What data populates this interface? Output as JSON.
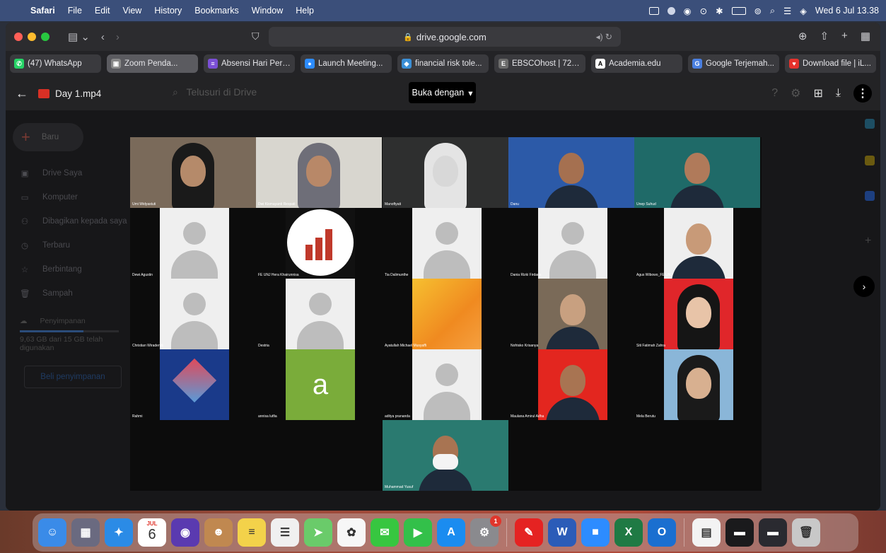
{
  "menubar": {
    "app": "Safari",
    "items": [
      "File",
      "Edit",
      "View",
      "History",
      "Bookmarks",
      "Window",
      "Help"
    ],
    "clock": "Wed 6 Jul 13.38"
  },
  "safari": {
    "url": "drive.google.com",
    "tabs": [
      {
        "label": "(47) WhatsApp",
        "icon": "whatsapp-icon",
        "color": "#25d366",
        "glyph": "✆"
      },
      {
        "label": "Zoom Penda...",
        "icon": "zoom-icon",
        "color": "#888888",
        "glyph": "▣",
        "active": true
      },
      {
        "label": "Absensi Hari Pert...",
        "icon": "forms-icon",
        "color": "#7b4fd6",
        "glyph": "≡"
      },
      {
        "label": "Launch Meeting...",
        "icon": "zoom-icon",
        "color": "#2d8cff",
        "glyph": "●"
      },
      {
        "label": "financial risk tole...",
        "icon": "web-icon",
        "color": "#3b8fd6",
        "glyph": "◆"
      },
      {
        "label": "EBSCOhost | 723...",
        "icon": "ebsco-icon",
        "color": "#6b6b6b",
        "glyph": "E"
      },
      {
        "label": "Academia.edu",
        "icon": "academia-icon",
        "color": "#ffffff",
        "glyph": "A"
      },
      {
        "label": "Google Terjemah...",
        "icon": "translate-icon",
        "color": "#4a7fe0",
        "glyph": "G"
      },
      {
        "label": "Download file | iL...",
        "icon": "ilovepdf-icon",
        "color": "#e5322d",
        "glyph": "♥"
      }
    ]
  },
  "drive": {
    "file_name": "Day 1.mp4",
    "search_placeholder": "Telusuri di Drive",
    "open_with": "Buka dengan",
    "sidebar": {
      "new_label": "Baru",
      "items": [
        {
          "label": "Drive Saya",
          "icon": "drive-icon",
          "glyph": "▣"
        },
        {
          "label": "Komputer",
          "icon": "computer-icon",
          "glyph": "▭"
        },
        {
          "label": "Dibagikan kepada saya",
          "icon": "shared-icon",
          "glyph": "⚇"
        },
        {
          "label": "Terbaru",
          "icon": "clock-icon",
          "glyph": "◷"
        },
        {
          "label": "Berbintang",
          "icon": "star-icon",
          "glyph": "☆"
        },
        {
          "label": "Sampah",
          "icon": "trash-icon",
          "glyph": "🗑"
        }
      ],
      "storage_label": "Penyimpanan",
      "storage_text": "9,63 GB dari 15 GB telah digunakan",
      "storage_used_fraction": 0.64,
      "buy_label": "Beli penyimpanan"
    }
  },
  "video": {
    "participants": [
      {
        "name": "Umi Widyastuti",
        "kind": "cam",
        "bg": "#7a6a5a",
        "skin": "#b58a6a",
        "hijab": "#1a1a1a"
      },
      {
        "name": "Dwi Kismayanti Respati",
        "kind": "cam",
        "bg": "#d8d6cf",
        "skin": "#b88868",
        "hijab": "#6e6e78"
      },
      {
        "name": "Manoftyati",
        "kind": "cam",
        "bg": "#2e2f2f",
        "skin": "#d8d8d8",
        "hijab": "#e4e4e4"
      },
      {
        "name": "Danu",
        "kind": "cam",
        "bg": "#2c5aa8",
        "skin": "#a57050",
        "hijab": ""
      },
      {
        "name": "Unep Suhud",
        "kind": "cam",
        "bg": "#1f6a68",
        "skin": "#b07a5a",
        "hijab": ""
      },
      {
        "name": "Dewi Agustin",
        "kind": "avatar"
      },
      {
        "name": "FE UNJ Hera Khairunnisa",
        "kind": "logo",
        "bg": "#ffffff"
      },
      {
        "name": "Tia Dalimunthe",
        "kind": "avatar"
      },
      {
        "name": "Dania Rizki Firdaus",
        "kind": "avatar"
      },
      {
        "name": "Agus Wibowo_FE UNJ",
        "kind": "cam",
        "bg": "#eeeeee",
        "skin": "#c89a78",
        "hijab": ""
      },
      {
        "name": "Christian Wiradendi",
        "kind": "avatar"
      },
      {
        "name": "Destria",
        "kind": "avatar"
      },
      {
        "name": "Ayatullah Michael Musyaffi",
        "kind": "image",
        "bg": "#f0a030"
      },
      {
        "name": "Nofrisko Krisanya",
        "kind": "cam",
        "bg": "#7a6a58",
        "skin": "#c8a080",
        "hijab": ""
      },
      {
        "name": "Siti Fatimah Zahra",
        "kind": "cam",
        "bg": "#e0262a",
        "skin": "#e8c4a8",
        "hijab": "#151515"
      },
      {
        "name": "Rahmi",
        "kind": "image",
        "bg": "#1a3a8a"
      },
      {
        "name": "annisa lutfia",
        "kind": "letter",
        "bg": "#7aac3a",
        "letter": "a"
      },
      {
        "name": "aditya prananda",
        "kind": "avatar"
      },
      {
        "name": "Maulana Amirul Adha",
        "kind": "cam",
        "bg": "#e3261f",
        "skin": "#a87452",
        "hijab": ""
      },
      {
        "name": "Mela Berutu",
        "kind": "cam",
        "bg": "#8ab6d8",
        "skin": "#d8b090",
        "hijab": "#1a1a1a"
      },
      {
        "name": "Muhammad Yusuf",
        "kind": "cam",
        "bg": "#2a7a70",
        "skin": "#a87452",
        "hijab": ""
      }
    ]
  },
  "dock": {
    "calendar_month": "JUL",
    "calendar_day": "6",
    "settings_badge": "1",
    "apps": [
      {
        "name": "finder-icon",
        "color": "#3a8be8",
        "glyph": "☺"
      },
      {
        "name": "launchpad-icon",
        "color": "#6a6a80",
        "glyph": "▦"
      },
      {
        "name": "safari-icon",
        "color": "#2b8be6",
        "glyph": "✦"
      },
      {
        "name": "calendar-icon",
        "color": "#ffffff",
        "glyph": ""
      },
      {
        "name": "siri-icon",
        "color": "#5a3ab0",
        "glyph": "◉"
      },
      {
        "name": "contacts-icon",
        "color": "#c08850",
        "glyph": "☻"
      },
      {
        "name": "notes-icon",
        "color": "#f3d24a",
        "glyph": "≡"
      },
      {
        "name": "reminders-icon",
        "color": "#f0f0f0",
        "glyph": "☰"
      },
      {
        "name": "maps-icon",
        "color": "#6acb6a",
        "glyph": "➤"
      },
      {
        "name": "photos-icon",
        "color": "#f7f7f7",
        "glyph": "✿"
      },
      {
        "name": "messages-icon",
        "color": "#37c640",
        "glyph": "✉"
      },
      {
        "name": "facetime-icon",
        "color": "#33c04a",
        "glyph": "▶"
      },
      {
        "name": "appstore-icon",
        "color": "#1a8cf0",
        "glyph": "A"
      },
      {
        "name": "system-preferences-icon",
        "color": "#8a8a8e",
        "glyph": "⚙"
      },
      {
        "name": "acrobat-icon",
        "color": "#e52322",
        "glyph": "✎"
      },
      {
        "name": "word-icon",
        "color": "#2b5cb8",
        "glyph": "W"
      },
      {
        "name": "zoom-icon",
        "color": "#2d8cff",
        "glyph": "■"
      },
      {
        "name": "excel-icon",
        "color": "#1f7a44",
        "glyph": "X"
      },
      {
        "name": "outlook-icon",
        "color": "#1a6fd0",
        "glyph": "O"
      },
      {
        "name": "document-thumb-icon",
        "color": "#f3f3f3",
        "glyph": "▤"
      },
      {
        "name": "window-thumb-icon",
        "color": "#1a1a1c",
        "glyph": "▬"
      },
      {
        "name": "window-thumb-icon-2",
        "color": "#2a2a30",
        "glyph": "▬"
      },
      {
        "name": "trash-icon",
        "color": "#c8c8c8",
        "glyph": "🗑"
      }
    ]
  }
}
